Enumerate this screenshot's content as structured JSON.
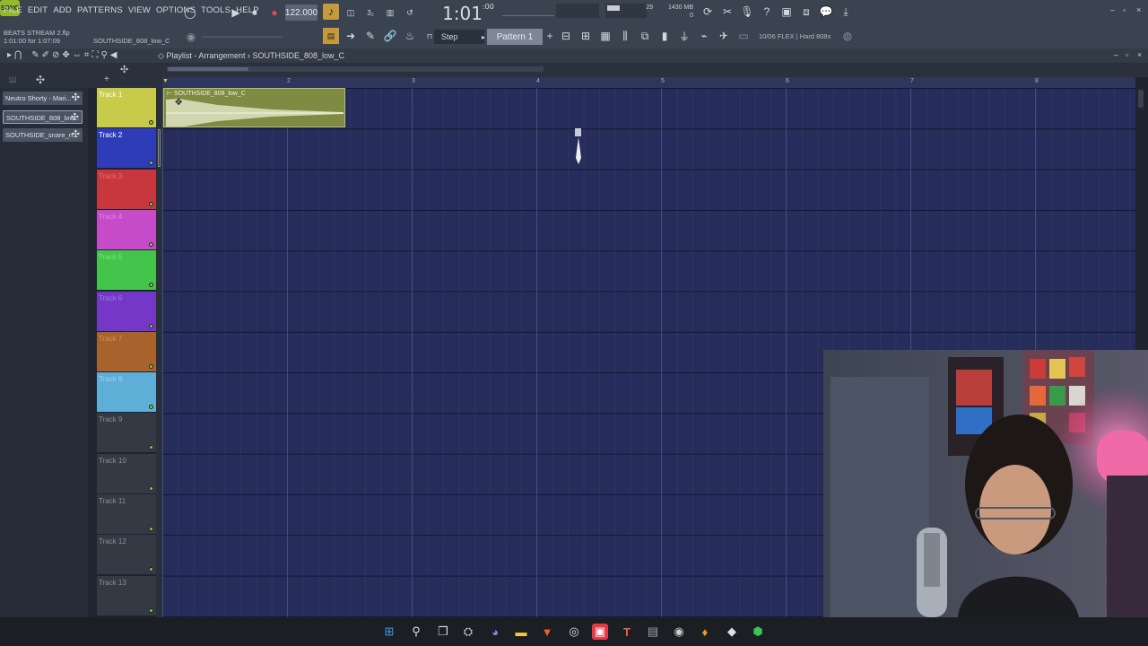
{
  "menu": [
    "FILE",
    "EDIT",
    "ADD",
    "PATTERNS",
    "VIEW",
    "OPTIONS",
    "TOOLS",
    "HELP"
  ],
  "transport": {
    "song_label": "SONG",
    "tempo": "122.000",
    "time": "1:01",
    "time_sub": ":00"
  },
  "project": {
    "name": "BEATS STREAM 2.flp",
    "duration": "1:01:00 for 1:07:09",
    "hint_track": "SOUTHSIDE_808_low_C"
  },
  "step_label": "Step",
  "pattern_label": "Pattern 1",
  "flex_info": "10/06  FLEX | Hard 808s",
  "cpu": {
    "line1": "1430 MB",
    "line2": "29",
    "line3": "0"
  },
  "playlist": {
    "title": "Playlist - Arrangement",
    "breadcrumb_arrow": "›",
    "clip_name": "SOUTHSIDE_808_low_C"
  },
  "ruler": [
    "2",
    "3",
    "4",
    "5",
    "6",
    "7",
    "8"
  ],
  "patterns": [
    {
      "label": "Neutro Shorty - Mari..."
    },
    {
      "label": "SOUTHSIDE_808_low..."
    },
    {
      "label": "SOUTHSIDE_snare_n..."
    }
  ],
  "tracks": [
    {
      "label": "Track 1",
      "color": "#c8cb4a",
      "text": "#ffffff"
    },
    {
      "label": "Track 2",
      "color": "#2f3cb8",
      "text": "#ffffff"
    },
    {
      "label": "Track 3",
      "color": "#c8373d",
      "text": "#e07070"
    },
    {
      "label": "Track 4",
      "color": "#c64bc9",
      "text": "#e088e0"
    },
    {
      "label": "Track 5",
      "color": "#43c54b",
      "text": "#7ee080"
    },
    {
      "label": "Track 6",
      "color": "#7437c8",
      "text": "#a07ae0"
    },
    {
      "label": "Track 7",
      "color": "#a8622c",
      "text": "#d09060"
    },
    {
      "label": "Track 8",
      "color": "#5eaed8",
      "text": "#9ed0ec"
    },
    {
      "label": "Track 9",
      "color": "#343a44",
      "text": "#8a909a"
    },
    {
      "label": "Track 10",
      "color": "#343a44",
      "text": "#8a909a"
    },
    {
      "label": "Track 11",
      "color": "#343a44",
      "text": "#8a909a"
    },
    {
      "label": "Track 12",
      "color": "#343a44",
      "text": "#8a909a"
    },
    {
      "label": "Track 13",
      "color": "#343a44",
      "text": "#8a909a"
    }
  ],
  "taskbar_icons": [
    "windows-icon",
    "search-icon",
    "task-view-icon",
    "steam-icon",
    "discord-icon",
    "file-explorer-icon",
    "brave-icon",
    "chrome-icon",
    "streamlabs-icon",
    "typeface-icon",
    "app-icon",
    "obs-icon",
    "fl-studio-icon",
    "epic-icon",
    "xbox-icon"
  ]
}
